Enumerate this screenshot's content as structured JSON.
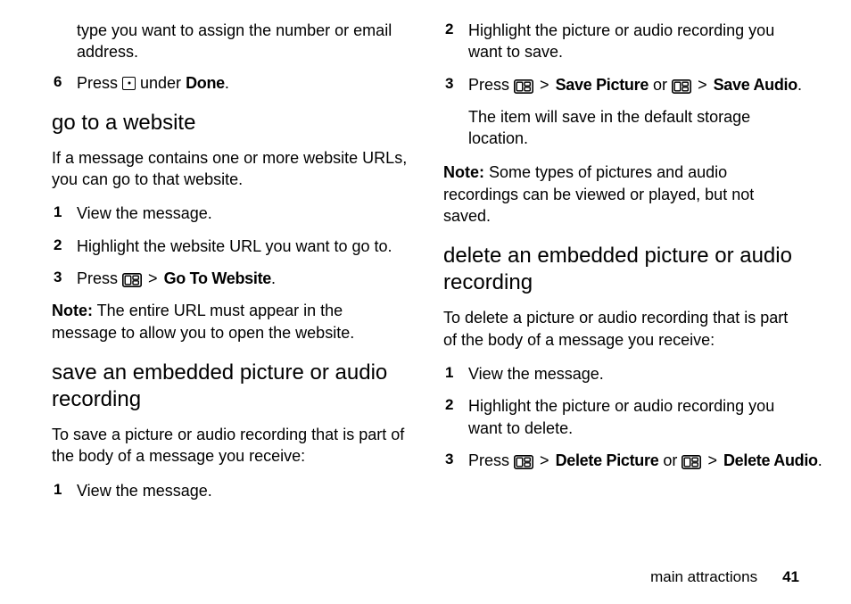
{
  "colA": {
    "cont": "type you want to assign the number or email address.",
    "step6": {
      "num": "6",
      "t1": "Press ",
      "t2": " under ",
      "done": "Done",
      "t3": "."
    },
    "gotoH": "go to a website",
    "gotoP": "If a message contains one or more website URLs, you can go to that website.",
    "g1": {
      "num": "1",
      "text": "View the message."
    },
    "g2": {
      "num": "2",
      "text": "Highlight the website URL you want to go to."
    },
    "g3": {
      "num": "3",
      "t1": "Press ",
      "sep": ">",
      "opt": "Go To Website",
      "t2": "."
    },
    "gotoNoteB": "Note:",
    "gotoNote": " The entire URL must appear in the message to allow you to open the website.",
    "saveH": "save an embedded picture or audio recording",
    "saveP": "To save a picture or audio recording that is part of the body of a message you receive:"
  },
  "colB": {
    "s1": {
      "num": "1",
      "text": "View the message."
    },
    "s2": {
      "num": "2",
      "text": "Highlight the picture or audio recording you want to save."
    },
    "s3": {
      "num": "3",
      "t1": "Press ",
      "sep": ">",
      "opt1": "Save Picture",
      "or": " or ",
      "opt2": "Save Audio",
      "t2": "."
    },
    "saveLoc": "The item will save in the default storage location.",
    "saveNoteB": "Note:",
    "saveNote": " Some types of pictures and audio recordings can be viewed or played, but not saved.",
    "delH": "delete an embedded picture or audio recording",
    "delP": "To delete a picture or audio recording that is part of the body of a message you receive:",
    "d1": {
      "num": "1",
      "text": "View the message."
    },
    "d2": {
      "num": "2",
      "text": "Highlight the picture or audio recording you want to delete."
    },
    "d3": {
      "num": "3",
      "t1": "Press ",
      "sep": ">",
      "opt1": "Delete Picture",
      "or": " or ",
      "opt2": "Delete Audio",
      "t2": "."
    }
  },
  "footer": {
    "section": "main attractions",
    "page": "41"
  }
}
